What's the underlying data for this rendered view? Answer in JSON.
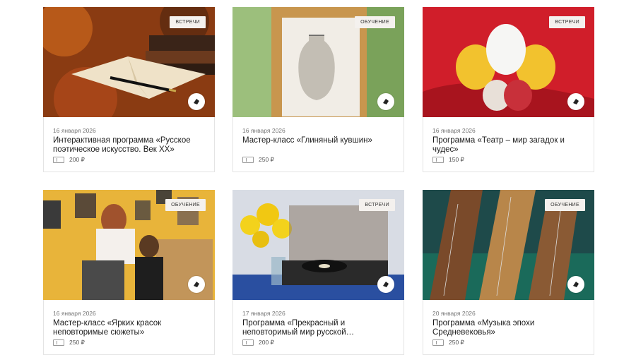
{
  "cards": [
    {
      "tag": "ВСТРЕЧИ",
      "date": "16 января 2026",
      "title": "Интерактивная программа «Русское поэтическое искусство. Век XX»",
      "price": "200 ₽"
    },
    {
      "tag": "ОБУЧЕНИЕ",
      "date": "16 января 2026",
      "title": "Мастер-класс «Глиняный кувшин»",
      "price": "250 ₽"
    },
    {
      "tag": "ВСТРЕЧИ",
      "date": "16 января 2026",
      "title": "Программа «Театр – мир загадок и чудес»",
      "price": "150 ₽"
    },
    {
      "tag": "ОБУЧЕНИЕ",
      "date": "16 января 2026",
      "title": "Мастер-класс «Ярких красок неповторимые сюжеты»",
      "price": "250 ₽"
    },
    {
      "tag": "ВСТРЕЧИ",
      "date": "17 января 2026",
      "title": "Программа «Прекрасный и неповторимый мир русской…",
      "price": "200 ₽"
    },
    {
      "tag": "ОБУЧЕНИЕ",
      "date": "20 января 2026",
      "title": "Программа «Музыка эпохи Средневековья»",
      "price": "250 ₽"
    }
  ],
  "icons": {
    "share": "share-icon",
    "ticket": "ticket-icon"
  }
}
